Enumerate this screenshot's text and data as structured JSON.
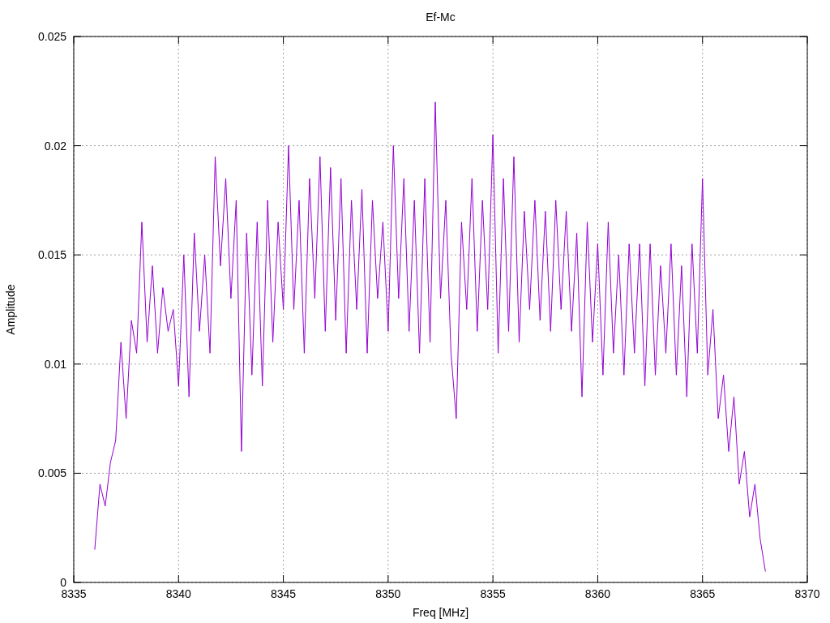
{
  "chart_data": {
    "type": "line",
    "grid": true,
    "title": "Ef-Mc",
    "xlabel": "Freq [MHz]",
    "ylabel": "Amplitude",
    "xlim": [
      8335,
      8370
    ],
    "ylim": [
      0,
      0.025
    ],
    "xticks": [
      8335,
      8340,
      8345,
      8350,
      8355,
      8360,
      8365,
      8370
    ],
    "yticks": [
      0,
      0.005,
      0.01,
      0.015,
      0.02,
      0.025
    ],
    "x": [
      8336,
      8336.25,
      8336.5,
      8336.75,
      8337,
      8337.25,
      8337.5,
      8337.75,
      8338,
      8338.25,
      8338.5,
      8338.75,
      8339,
      8339.25,
      8339.5,
      8339.75,
      8340,
      8340.25,
      8340.5,
      8340.75,
      8341,
      8341.25,
      8341.5,
      8341.75,
      8342,
      8342.25,
      8342.5,
      8342.75,
      8343,
      8343.25,
      8343.5,
      8343.75,
      8344,
      8344.25,
      8344.5,
      8344.75,
      8345,
      8345.25,
      8345.5,
      8345.75,
      8346,
      8346.25,
      8346.5,
      8346.75,
      8347,
      8347.25,
      8347.5,
      8347.75,
      8348,
      8348.25,
      8348.5,
      8348.75,
      8349,
      8349.25,
      8349.5,
      8349.75,
      8350,
      8350.25,
      8350.5,
      8350.75,
      8351,
      8351.25,
      8351.5,
      8351.75,
      8352,
      8352.25,
      8352.5,
      8352.75,
      8353,
      8353.25,
      8353.5,
      8353.75,
      8354,
      8354.25,
      8354.5,
      8354.75,
      8355,
      8355.25,
      8355.5,
      8355.75,
      8356,
      8356.25,
      8356.5,
      8356.75,
      8357,
      8357.25,
      8357.5,
      8357.75,
      8358,
      8358.25,
      8358.5,
      8358.75,
      8359,
      8359.25,
      8359.5,
      8359.75,
      8360,
      8360.25,
      8360.5,
      8360.75,
      8361,
      8361.25,
      8361.5,
      8361.75,
      8362,
      8362.25,
      8362.5,
      8362.75,
      8363,
      8363.25,
      8363.5,
      8363.75,
      8364,
      8364.25,
      8364.5,
      8364.75,
      8365,
      8365.25,
      8365.5,
      8365.75,
      8366,
      8366.25,
      8366.5,
      8366.75,
      8367,
      8367.25,
      8367.5,
      8367.75,
      8368
    ],
    "series": [
      {
        "color": "#9400d3",
        "values": [
          0.0015,
          0.0045,
          0.0035,
          0.0055,
          0.0065,
          0.011,
          0.0075,
          0.012,
          0.0105,
          0.0165,
          0.011,
          0.0145,
          0.0105,
          0.0135,
          0.0115,
          0.0125,
          0.009,
          0.015,
          0.0085,
          0.016,
          0.0115,
          0.015,
          0.0105,
          0.0195,
          0.0145,
          0.0185,
          0.013,
          0.0175,
          0.006,
          0.016,
          0.0095,
          0.0165,
          0.009,
          0.0175,
          0.011,
          0.0165,
          0.0125,
          0.02,
          0.0125,
          0.0175,
          0.0105,
          0.0185,
          0.013,
          0.0195,
          0.0115,
          0.019,
          0.012,
          0.0185,
          0.0105,
          0.0175,
          0.0125,
          0.018,
          0.0105,
          0.0175,
          0.013,
          0.0165,
          0.0115,
          0.02,
          0.013,
          0.0185,
          0.0115,
          0.0175,
          0.0105,
          0.0185,
          0.011,
          0.022,
          0.013,
          0.0175,
          0.0105,
          0.0075,
          0.0165,
          0.0125,
          0.0185,
          0.0115,
          0.0175,
          0.0125,
          0.0205,
          0.0105,
          0.0185,
          0.0115,
          0.0195,
          0.011,
          0.017,
          0.0125,
          0.0175,
          0.012,
          0.017,
          0.0115,
          0.0175,
          0.0125,
          0.017,
          0.0115,
          0.016,
          0.0085,
          0.0165,
          0.011,
          0.0155,
          0.0095,
          0.0165,
          0.0105,
          0.015,
          0.0095,
          0.0155,
          0.0105,
          0.0155,
          0.009,
          0.0155,
          0.0095,
          0.0145,
          0.0105,
          0.0155,
          0.0095,
          0.0145,
          0.0085,
          0.0155,
          0.0105,
          0.0185,
          0.0095,
          0.0125,
          0.0075,
          0.0095,
          0.006,
          0.0085,
          0.0045,
          0.006,
          0.003,
          0.0045,
          0.002,
          0.0005
        ]
      }
    ]
  }
}
